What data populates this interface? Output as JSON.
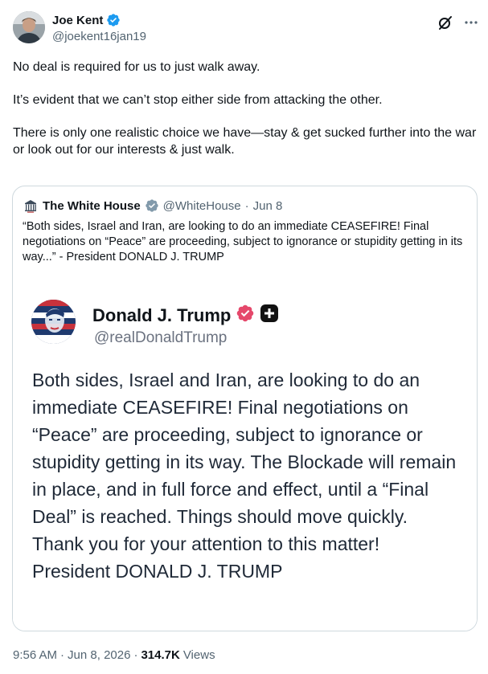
{
  "author": {
    "name": "Joe Kent",
    "handle": "@joekent16jan19",
    "avatar_icon": "avatar-photo",
    "verified_icon": "verified-badge-icon"
  },
  "header_actions": {
    "grok_icon": "grok-icon",
    "more_icon": "more-icon"
  },
  "body": {
    "paragraphs": [
      "No deal is required for us to just walk away.",
      "It’s evident that we can’t stop either side from attacking the other.",
      "There is only one realistic choice we have—stay & get sucked further into the war or look out for our interests & just walk."
    ]
  },
  "quote": {
    "name": "The White House",
    "handle": "@WhiteHouse",
    "separator": "·",
    "date": "Jun 8",
    "text": "“Both sides, Israel and Iran, are looking to do an immediate CEASEFIRE! Final negotiations on “Peace” are proceeding, subject to ignorance or stupidity getting in its way...” - President DONALD J. TRUMP",
    "embedded": {
      "name": "Donald J. Trump",
      "handle": "@realDonaldTrump",
      "text": "Both sides, Israel and Iran, are looking to do an immediate CEASEFIRE! Final negotiations on “Peace” are proceeding, subject to ignorance or stupidity getting in its way. The Blockade will remain in place, and in full force and effect, until a “Final Deal” is reached. Things should move quickly. Thank you for your attention to this matter! President DONALD J. TRUMP",
      "verified_color": "#e5486b"
    }
  },
  "meta": {
    "time": "9:56 AM",
    "sep1": "·",
    "date": "Jun 8, 2026",
    "sep2": "·",
    "views_count": "314.7K",
    "views_label": "Views"
  },
  "colors": {
    "text": "#0f1419",
    "secondary": "#536471",
    "verified_blue": "#1d9bf0",
    "border": "#cfd9de"
  }
}
